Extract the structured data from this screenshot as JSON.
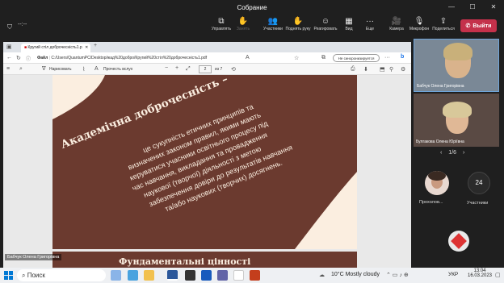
{
  "window": {
    "title": "Собрание",
    "minimize": "—",
    "maximize": "☐",
    "close": "✕"
  },
  "meeting": {
    "toolbar": [
      {
        "label": "Управлять",
        "glyph": "⧉",
        "disabled": false
      },
      {
        "label": "Занять",
        "glyph": "✋",
        "disabled": true
      },
      {
        "label": "Участники",
        "glyph": "👥",
        "disabled": false
      },
      {
        "label": "Поднять руку",
        "glyph": "✋",
        "disabled": false
      },
      {
        "label": "Реагировать",
        "glyph": "☺",
        "disabled": false
      },
      {
        "label": "Вид",
        "glyph": "▦",
        "disabled": false
      },
      {
        "label": "Еще",
        "glyph": "···",
        "disabled": false
      },
      {
        "label": "Камера",
        "glyph": "🎥",
        "disabled": false
      },
      {
        "label": "Микрофон",
        "glyph": "🎙",
        "disabled": false
      },
      {
        "label": "Поделиться",
        "glyph": "⇪",
        "disabled": false
      }
    ],
    "leave_label": "Выйти",
    "meeting_time": "--:--",
    "presenter_name": "Бабчук Олена Григорівна",
    "participants": [
      {
        "name": "Бабчук Олена Григорівна",
        "bg": "#6b7a88"
      },
      {
        "name": "Булгакова Олена Юріївна",
        "bg": "#5a4a44"
      }
    ],
    "page_indicator": "1/6",
    "small_tiles": [
      {
        "name": "Прохолов..."
      },
      {
        "name": "Участники",
        "count": "24"
      }
    ]
  },
  "browser": {
    "tab_title": "Кругий стіл доброчесність1.p",
    "close": "✕",
    "new_tab": "+",
    "address_prefix": "Файл",
    "address": "C:/Users/QuantumPC/Desktop/жад%20добро/Кругий%20стіл%20доброчесність1.pdf",
    "sync_label": "Не синхронизируется",
    "pdf": {
      "draw_label": "Нарисовать",
      "read_label": "Прочесть вслух",
      "zoom_out": "−",
      "zoom_in": "+",
      "page": "2",
      "page_total": "из 7"
    }
  },
  "slide": {
    "title": "Академічна доброчесність –",
    "body_lines": [
      "це сукупність етичних принципів та",
      "визначених законом правил, якими мають",
      "керуватися учасники освітнього процесу під",
      "час навчання, викладання та провадження",
      "наукової (творчої) діяльності з метою",
      "забезпечення довіри до результатів навчання",
      "та/або наукових (творчих) досягнень."
    ],
    "next_title": "Фундаментальні цінності",
    "colors": {
      "bg": "#6b3a2f",
      "accent": "#fbeee0"
    }
  },
  "taskbar": {
    "search_label": "Поиск",
    "weather": "10°C  Mostly cloudy",
    "lang": "УКР",
    "time": "13:04",
    "date": "16.03.2023"
  }
}
